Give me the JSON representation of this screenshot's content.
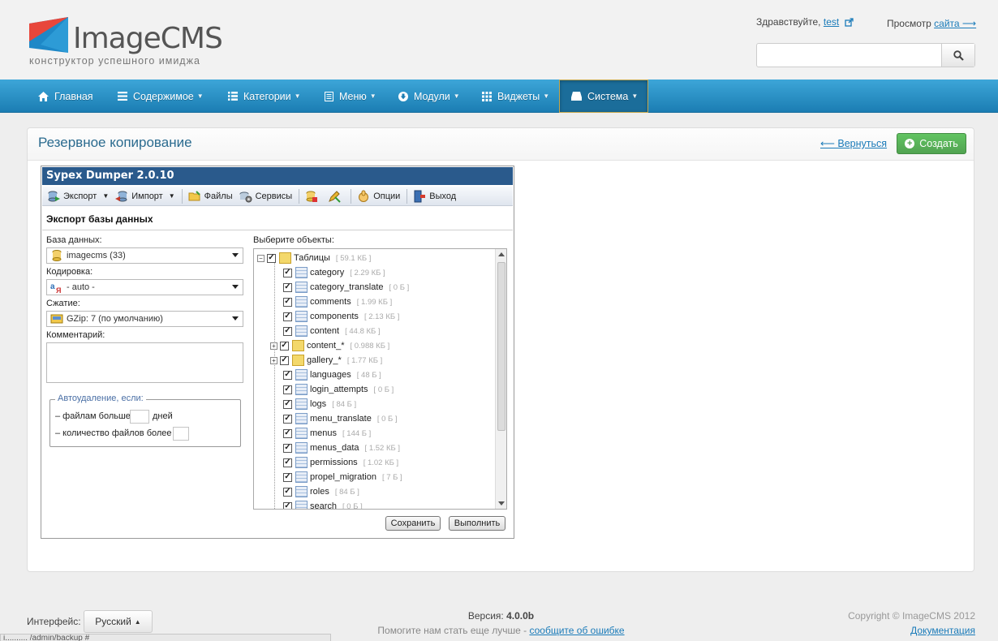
{
  "header": {
    "logo_text": "ImageCMS",
    "logo_tagline": "конструктор успешного имиджа",
    "greeting": "Здравствуйте,",
    "user": "test",
    "preview_label": "Просмотр",
    "preview_link": "сайта ⟶",
    "search_placeholder": ""
  },
  "nav": {
    "items": [
      {
        "label": "Главная",
        "icon": "home-icon"
      },
      {
        "label": "Содержимое",
        "icon": "list-icon"
      },
      {
        "label": "Категории",
        "icon": "list-icon"
      },
      {
        "label": "Меню",
        "icon": "menu-icon"
      },
      {
        "label": "Модули",
        "icon": "download-icon"
      },
      {
        "label": "Виджеты",
        "icon": "grid-icon"
      },
      {
        "label": "Система",
        "icon": "hdd-icon"
      }
    ],
    "active": "Система"
  },
  "page": {
    "title": "Резервное копирование",
    "back_link": "⟵ Вернуться",
    "create_button": "Создать"
  },
  "dumper": {
    "title": "Sypex Dumper 2.0.10",
    "toolbar": {
      "export": "Экспорт",
      "import": "Импорт",
      "files": "Файлы",
      "services": "Сервисы",
      "options": "Опции",
      "exit": "Выход"
    },
    "section_title": "Экспорт базы данных",
    "db_label": "База данных:",
    "db_value": "imagecms (33)",
    "charset_label": "Кодировка:",
    "charset_value": "- auto -",
    "compress_label": "Сжатие:",
    "compress_value": "GZip: 7 (по умолчанию)",
    "comment_label": "Комментарий:",
    "autodelete_legend": "Автоудаление, если:",
    "files_older": "– файлам больше",
    "days": "дней",
    "files_count": "– количество файлов более",
    "objects_label": "Выберите объекты:",
    "tree_root": "Таблицы",
    "tree_root_size": "[ 59.1 КБ ]",
    "tables": [
      {
        "name": "category",
        "size": "[ 2.29 КБ ]",
        "group": false
      },
      {
        "name": "category_translate",
        "size": "[ 0 Б ]",
        "group": false
      },
      {
        "name": "comments",
        "size": "[ 1.99 КБ ]",
        "group": false
      },
      {
        "name": "components",
        "size": "[ 2.13 КБ ]",
        "group": false
      },
      {
        "name": "content",
        "size": "[ 44.8 КБ ]",
        "group": false
      },
      {
        "name": "content_*",
        "size": "[ 0.988 КБ ]",
        "group": true
      },
      {
        "name": "gallery_*",
        "size": "[ 1.77 КБ ]",
        "group": true
      },
      {
        "name": "languages",
        "size": "[ 48 Б ]",
        "group": false
      },
      {
        "name": "login_attempts",
        "size": "[ 0 Б ]",
        "group": false
      },
      {
        "name": "logs",
        "size": "[ 84 Б ]",
        "group": false
      },
      {
        "name": "menu_translate",
        "size": "[ 0 Б ]",
        "group": false
      },
      {
        "name": "menus",
        "size": "[ 144 Б ]",
        "group": false
      },
      {
        "name": "menus_data",
        "size": "[ 1.52 КБ ]",
        "group": false
      },
      {
        "name": "permissions",
        "size": "[ 1.02 КБ ]",
        "group": false
      },
      {
        "name": "propel_migration",
        "size": "[ 7 Б ]",
        "group": false
      },
      {
        "name": "roles",
        "size": "[ 84 Б ]",
        "group": false
      },
      {
        "name": "search",
        "size": "[ 0 Б ]",
        "group": false
      }
    ],
    "save_button": "Сохранить",
    "run_button": "Выполнить"
  },
  "footer": {
    "interface_label": "Интерфейс:",
    "language": "Русский",
    "version_label": "Версия:",
    "version": "4.0.0b",
    "help_text": "Помогите нам стать еще лучше -",
    "help_link": "сообщите об ошибке",
    "copyright": "Copyright © ImageCMS 2012",
    "docs_link": "Документация",
    "status_url": "i.......... /admin/backup #"
  },
  "colors": {
    "nav_bg": "#2a8fc6",
    "create_green": "#5bb75b",
    "dumper_title": "#2a5a8c",
    "link": "#1a7bb9"
  }
}
